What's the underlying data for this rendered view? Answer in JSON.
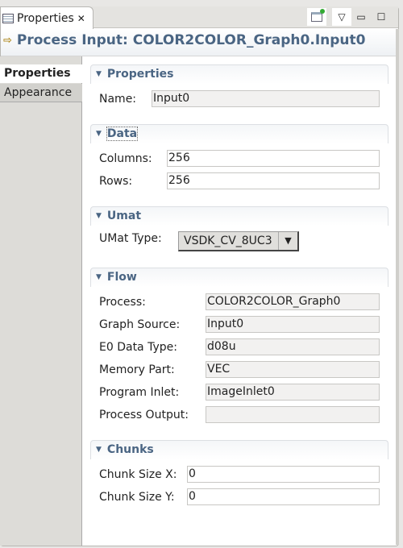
{
  "tab": {
    "label": "Properties"
  },
  "title": "Process Input: COLOR2COLOR_Graph0.Input0",
  "left_tabs": [
    "Properties",
    "Appearance"
  ],
  "sections": {
    "properties": {
      "title": "Properties",
      "name_label": "Name:",
      "name_value": "Input0"
    },
    "data": {
      "title": "Data",
      "columns_label": "Columns:",
      "columns_value": "256",
      "rows_label": "Rows:",
      "rows_value": "256"
    },
    "umat": {
      "title": "Umat",
      "type_label": "UMat Type:",
      "type_value": "VSDK_CV_8UC3"
    },
    "flow": {
      "title": "Flow",
      "rows": [
        {
          "label": "Process:",
          "value": "COLOR2COLOR_Graph0"
        },
        {
          "label": "Graph Source:",
          "value": "Input0"
        },
        {
          "label": "E0 Data Type:",
          "value": "d08u"
        },
        {
          "label": "Memory Part:",
          "value": "VEC"
        },
        {
          "label": "Program Inlet:",
          "value": "ImageInlet0"
        },
        {
          "label": "Process Output:",
          "value": ""
        }
      ]
    },
    "chunks": {
      "title": "Chunks",
      "x_label": "Chunk Size X:",
      "x_value": "0",
      "y_label": "Chunk Size Y:",
      "y_value": "0"
    }
  }
}
